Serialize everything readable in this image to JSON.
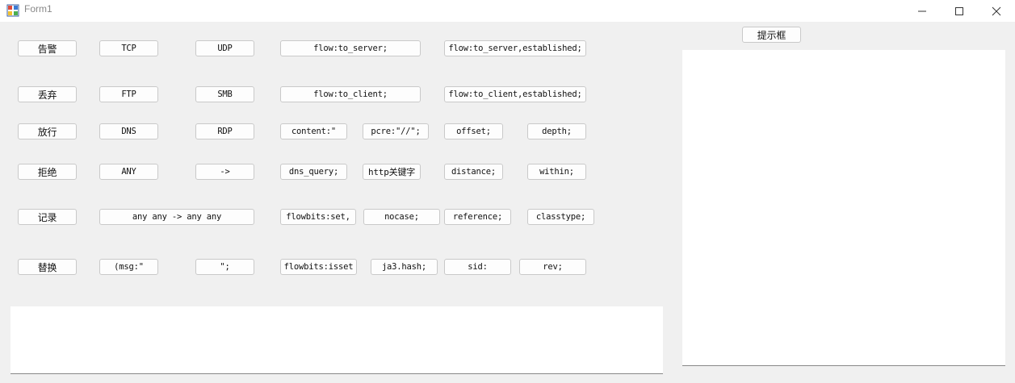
{
  "window": {
    "title": "Form1"
  },
  "buttons": {
    "alert": "告警",
    "tcp": "TCP",
    "udp": "UDP",
    "flow_to_server": "flow:to_server;",
    "flow_to_server_est": "flow:to_server,established;",
    "drop": "丢弃",
    "ftp": "FTP",
    "smb": "SMB",
    "flow_to_client": "flow:to_client;",
    "flow_to_client_est": "flow:to_client,established;",
    "pass": "放行",
    "dns": "DNS",
    "rdp": "RDP",
    "content": "content:\"",
    "pcre": "pcre:\"//\";",
    "offset": "offset;",
    "depth": "depth;",
    "reject": "拒绝",
    "any": "ANY",
    "arrow": "->",
    "dns_query": "dns_query;",
    "http_keyword": "http关键字",
    "distance": "distance;",
    "within": "within;",
    "log": "记录",
    "any_any": "any any -> any any",
    "flowbits_set": "flowbits:set,",
    "nocase": "nocase;",
    "reference": "reference;",
    "classtype": "classtype;",
    "replace": "替换",
    "msg": "(msg:\"",
    "quote_semi": "\";",
    "flowbits_isset": "flowbits:isset",
    "ja3_hash": "ja3.hash;",
    "sid": "sid:",
    "rev": "rev;",
    "tip": "提示框"
  }
}
